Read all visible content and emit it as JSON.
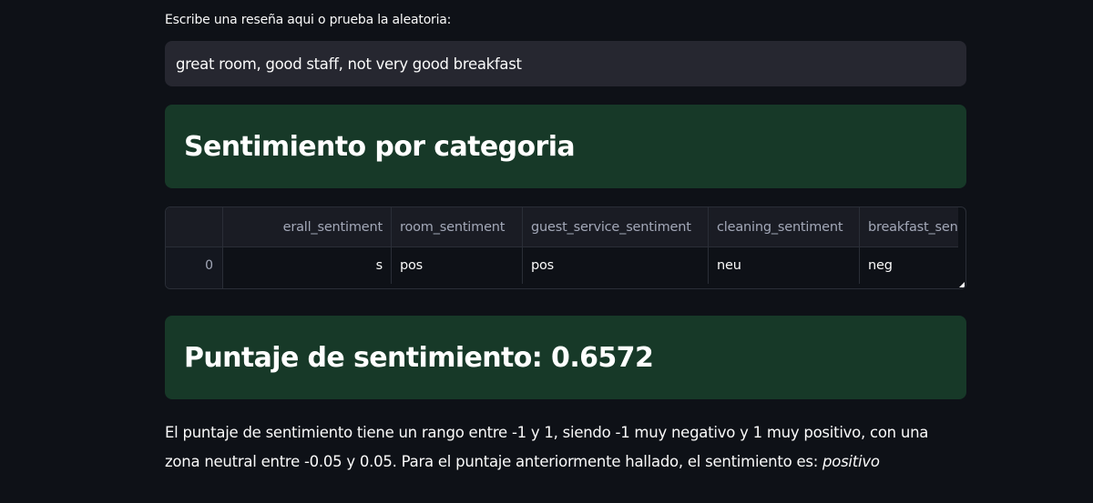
{
  "input": {
    "label": "Escribe una reseña aqui o prueba la aleatoria:",
    "value": "great room, good staff, not very good breakfast"
  },
  "section_category": {
    "title": "Sentimiento por categoria"
  },
  "table": {
    "columns": [
      "overall_sentiment",
      "room_sentiment",
      "guest_service_sentiment",
      "cleaning_sentiment",
      "breakfast_sentiment"
    ],
    "visible_columns": [
      "erall_sentiment",
      "room_sentiment",
      "guest_service_sentiment",
      "cleaning_sentiment",
      "breakfast_sentiment"
    ],
    "rows": [
      {
        "index": "0",
        "cells": [
          "s",
          "pos",
          "pos",
          "neu",
          "neg"
        ]
      }
    ]
  },
  "section_score": {
    "title": "Puntaje de sentimiento: 0.6572"
  },
  "explanation": {
    "text": "El puntaje de sentimiento tiene un rango entre -1 y 1, siendo -1 muy negativo y 1 muy positivo, con una zona neutral entre -0.05 y 0.05. Para el puntaje anteriormente hallado, el sentimiento es: ",
    "result": "positivo"
  },
  "colors": {
    "background": "#0e1117",
    "input_bg": "#262730",
    "success_bg": "#173928",
    "text": "#fafafa"
  }
}
